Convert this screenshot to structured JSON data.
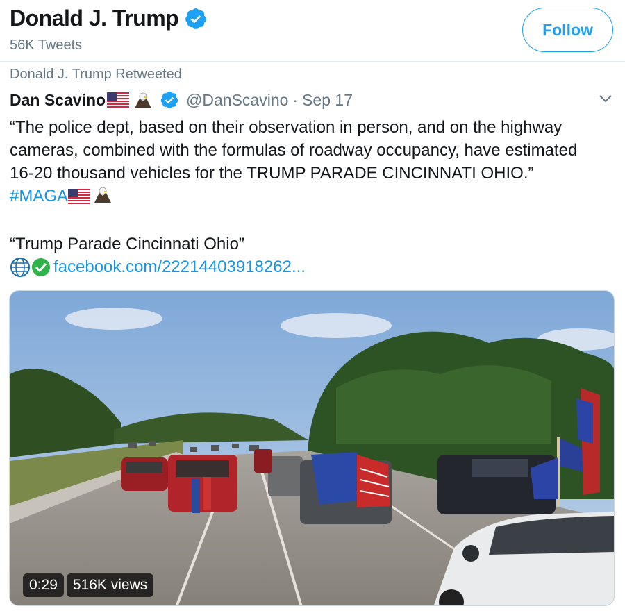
{
  "profile": {
    "name": "Donald J. Trump",
    "tweet_count": "56K Tweets",
    "follow_label": "Follow"
  },
  "tweet": {
    "retweet_label": "Donald J. Trump Retweeted",
    "author_name": "Dan Scavino",
    "author_handle": "@DanScavino",
    "separator": "·",
    "date": "Sep 17",
    "text_line1": "“The police dept, based on their observation in person, and on the highway",
    "text_line2": "cameras, combined with the formulas of roadway occupancy, have estimated",
    "text_line3": "16-20 thousand vehicles for the TRUMP PARADE CINCINNATI OHIO.”",
    "hashtag": "#MAGA",
    "card_title": "“Trump Parade Cincinnati Ohio”",
    "link_url": "facebook.com/22214403918262..."
  },
  "video": {
    "duration": "0:29",
    "views": "516K views"
  },
  "icons": {
    "verified": "verified-badge-icon",
    "flag": "us-flag-icon",
    "eagle": "eagle-icon",
    "globe": "globe-icon",
    "check": "green-check-icon",
    "chevron": "chevron-down-icon"
  },
  "colors": {
    "accent": "#1da1f2",
    "link": "#1b95e0",
    "muted": "#657786"
  }
}
